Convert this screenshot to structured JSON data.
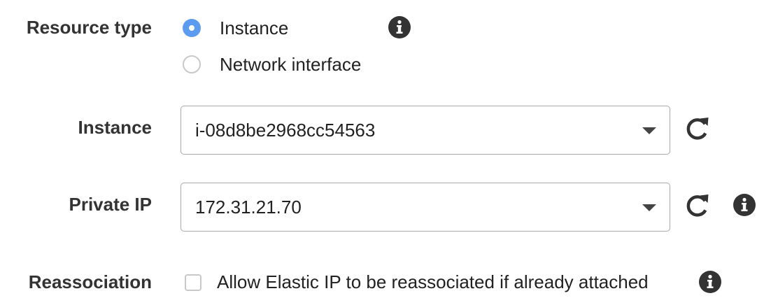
{
  "resource_type": {
    "label": "Resource type",
    "options": [
      {
        "label": "Instance",
        "selected": true
      },
      {
        "label": "Network interface",
        "selected": false
      }
    ],
    "info_icon": "info-icon"
  },
  "instance": {
    "label": "Instance",
    "value": "i-08d8be2968cc54563",
    "refresh_icon": "refresh-icon"
  },
  "private_ip": {
    "label": "Private IP",
    "value": "172.31.21.70",
    "refresh_icon": "refresh-icon",
    "info_icon": "info-icon"
  },
  "reassociation": {
    "label": "Reassociation",
    "checkbox_label": "Allow Elastic IP to be reassociated if already attached",
    "checked": false,
    "info_icon": "info-icon"
  },
  "colors": {
    "radio_selected": "#5b9bf0",
    "icon": "#333333",
    "border": "#a9a9a9"
  }
}
